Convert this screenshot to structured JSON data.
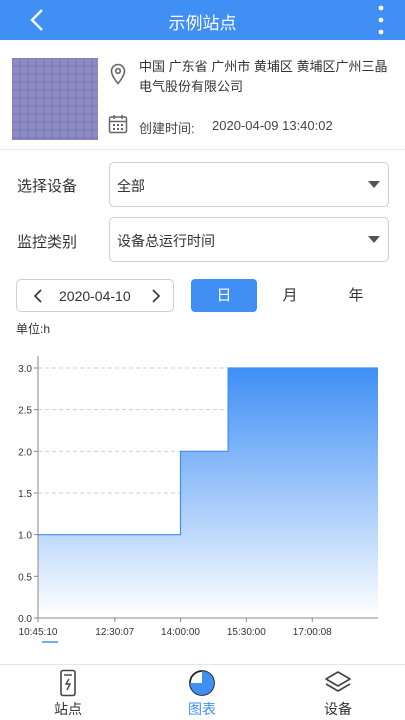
{
  "header": {
    "title": "示例站点",
    "back_icon": "chevron-left-icon",
    "more_icon": "more-vertical-icon"
  },
  "station": {
    "address": "中国 广东省 广州市 黄埔区 黄埔区广州三晶电气股份有限公司",
    "created_label": "创建时间:",
    "created_value": "2020-04-09 13:40:02"
  },
  "filters": {
    "device_label": "选择设备",
    "device_value": "全部",
    "monitor_label": "监控类别",
    "monitor_value": "设备总运行时间"
  },
  "date_nav": {
    "date": "2020-04-10"
  },
  "periods": {
    "day": "日",
    "month": "月",
    "year": "年",
    "active": "日"
  },
  "unit_label": "单位:h",
  "chart_data": {
    "type": "area",
    "ylim": [
      0,
      3.0
    ],
    "yticks": [
      "0.0",
      "0.5",
      "1.0",
      "1.5",
      "2.0",
      "2.5",
      "3.0"
    ],
    "xticks": [
      "10:45:10",
      "12:30:07",
      "14:00:00",
      "15:30:00",
      "17:00:08"
    ],
    "step": true,
    "x": [
      "10:45:10",
      "14:00:00",
      "14:00:00",
      "15:05:00",
      "15:05:00",
      "18:30:00"
    ],
    "values": [
      1.0,
      1.0,
      2.0,
      2.0,
      3.0,
      3.0
    ],
    "colors": {
      "fill_top": "#3f8ff5",
      "fill_bottom": "#ffffff",
      "line": "#3f8ff5"
    }
  },
  "tabs": [
    {
      "label": "站点",
      "icon": "station-icon"
    },
    {
      "label": "图表",
      "icon": "pie-chart-icon"
    },
    {
      "label": "设备",
      "icon": "layers-icon"
    }
  ],
  "colors": {
    "primary": "#3f8ff5"
  }
}
